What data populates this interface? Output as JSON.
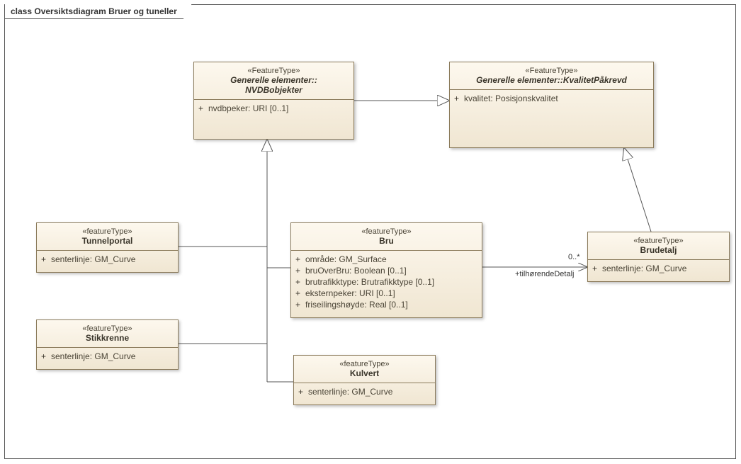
{
  "title": "class Oversiktsdiagram Bruer og tuneller",
  "classes": {
    "nvdb": {
      "stereo": "«FeatureType»",
      "name1": "Generelle elementer::",
      "name2": "NVDBobjekter",
      "attrs": [
        {
          "vis": "+",
          "text": "nvdbpeker: URI [0..1]"
        }
      ]
    },
    "kvalitet": {
      "stereo": "«FeatureType»",
      "name1": "Generelle elementer::KvalitetPåkrevd",
      "attrs": [
        {
          "vis": "+",
          "text": "kvalitet: Posisjonskvalitet"
        }
      ]
    },
    "tunnelportal": {
      "stereo": "«featureType»",
      "name": "Tunnelportal",
      "attrs": [
        {
          "vis": "+",
          "text": "senterlinje: GM_Curve"
        }
      ]
    },
    "stikkrenne": {
      "stereo": "«featureType»",
      "name": "Stikkrenne",
      "attrs": [
        {
          "vis": "+",
          "text": "senterlinje: GM_Curve"
        }
      ]
    },
    "kulvert": {
      "stereo": "«featureType»",
      "name": "Kulvert",
      "attrs": [
        {
          "vis": "+",
          "text": "senterlinje: GM_Curve"
        }
      ]
    },
    "bru": {
      "stereo": "«featureType»",
      "name": "Bru",
      "attrs": [
        {
          "vis": "+",
          "text": "område: GM_Surface"
        },
        {
          "vis": "+",
          "text": "bruOverBru: Boolean [0..1]"
        },
        {
          "vis": "+",
          "text": "brutrafikktype: Brutrafikktype [0..1]"
        },
        {
          "vis": "+",
          "text": "eksternpeker: URI [0..1]"
        },
        {
          "vis": "+",
          "text": "friseilingshøyde: Real [0..1]"
        }
      ]
    },
    "brudetalj": {
      "stereo": "«featureType»",
      "name": "Brudetalj",
      "attrs": [
        {
          "vis": "+",
          "text": "senterlinje: GM_Curve"
        }
      ]
    }
  },
  "assoc": {
    "role": "+tilhørendeDetalj",
    "mult": "0..*"
  }
}
